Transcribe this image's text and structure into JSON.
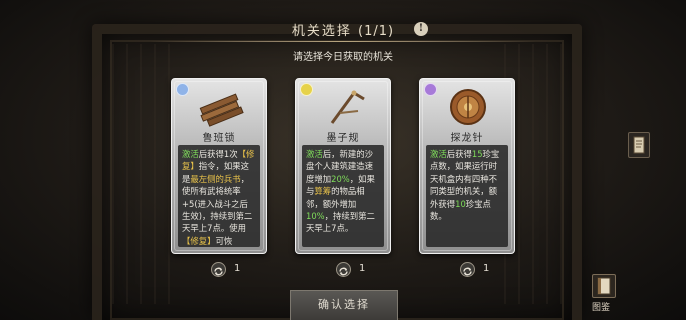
{
  "header": {
    "title": "机关选择",
    "count": "(1/1)",
    "info_icon": "info-icon"
  },
  "subtitle": "请选择今日获取的机关",
  "cards": [
    {
      "name": "鲁班锁",
      "badge_color": "#8fb3e8",
      "art_icon": "wooden-planks-icon",
      "desc": [
        {
          "t": "激活",
          "c": "g"
        },
        {
          "t": "后获得1次"
        },
        {
          "t": "【修复】",
          "c": "y"
        },
        {
          "t": "指令，如果这是"
        },
        {
          "t": "最左侧的兵书",
          "c": "y"
        },
        {
          "t": "，使所有武将统率+5(进入战斗之后生效)，持续到第二天早上7点。使用"
        },
        {
          "t": "【修复】",
          "c": "y"
        },
        {
          "t": "可恢"
        }
      ],
      "refresh_count": "1"
    },
    {
      "name": "墨子规",
      "badge_color": "#e6d24a",
      "art_icon": "ruler-square-icon",
      "desc": [
        {
          "t": "激活",
          "c": "g"
        },
        {
          "t": "后，新建的沙盘个人建筑建造速度增加"
        },
        {
          "t": "20%",
          "c": "g"
        },
        {
          "t": "，如果与"
        },
        {
          "t": "算筹",
          "c": "y"
        },
        {
          "t": "的物品相邻，额外增加"
        },
        {
          "t": "10%",
          "c": "g"
        },
        {
          "t": "，持续到第二天早上7点。"
        }
      ],
      "refresh_count": "1"
    },
    {
      "name": "探龙针",
      "badge_color": "#a77ad8",
      "art_icon": "compass-disc-icon",
      "desc": [
        {
          "t": "激活",
          "c": "g"
        },
        {
          "t": "后获得"
        },
        {
          "t": "15",
          "c": "g"
        },
        {
          "t": "珍宝点数，如果运行时天机盒内有四种不同类型的机关，额外获得"
        },
        {
          "t": "10",
          "c": "g"
        },
        {
          "t": "珍宝点数。"
        }
      ],
      "refresh_count": "1"
    }
  ],
  "confirm_button": "确认选择",
  "side": {
    "scroll_icon": "scroll-icon",
    "book_icon": "catalog-book-icon",
    "book_label": "图鉴"
  },
  "colors": {
    "highlight_green": "#7fdc5a",
    "highlight_yellow": "#e8c24a"
  }
}
